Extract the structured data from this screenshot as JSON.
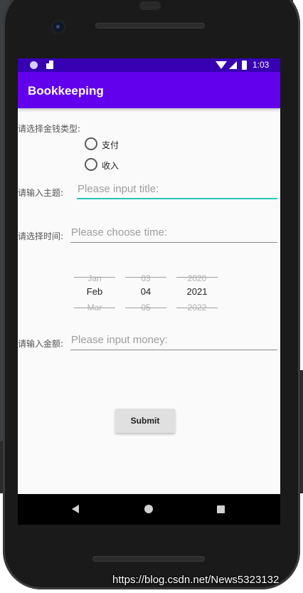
{
  "status_bar": {
    "time": "1:03"
  },
  "app": {
    "title": "Bookkeeping"
  },
  "form": {
    "money_type_label": "请选择金钱类型:",
    "radio_options": [
      {
        "label": "支付",
        "checked": false
      },
      {
        "label": "收入",
        "checked": false
      }
    ],
    "title_label": "请输入主题:",
    "title_placeholder": "Please input title:",
    "time_label": "请选择时间:",
    "time_placeholder": "Please choose time:",
    "money_label": "请输入金额:",
    "money_placeholder": "Please input money:",
    "submit_label": "Submit"
  },
  "date_picker": {
    "month": {
      "prev": "Jan",
      "selected": "Feb",
      "next": "Mar"
    },
    "day": {
      "prev": "03",
      "selected": "04",
      "next": "05"
    },
    "year": {
      "prev": "2020",
      "selected": "2021",
      "next": "2022"
    }
  },
  "watermark": "https://blog.csdn.net/News5323132",
  "colors": {
    "status_bar": "#3700b3",
    "app_bar": "#6200ee",
    "focus_accent": "#26c6b5"
  }
}
